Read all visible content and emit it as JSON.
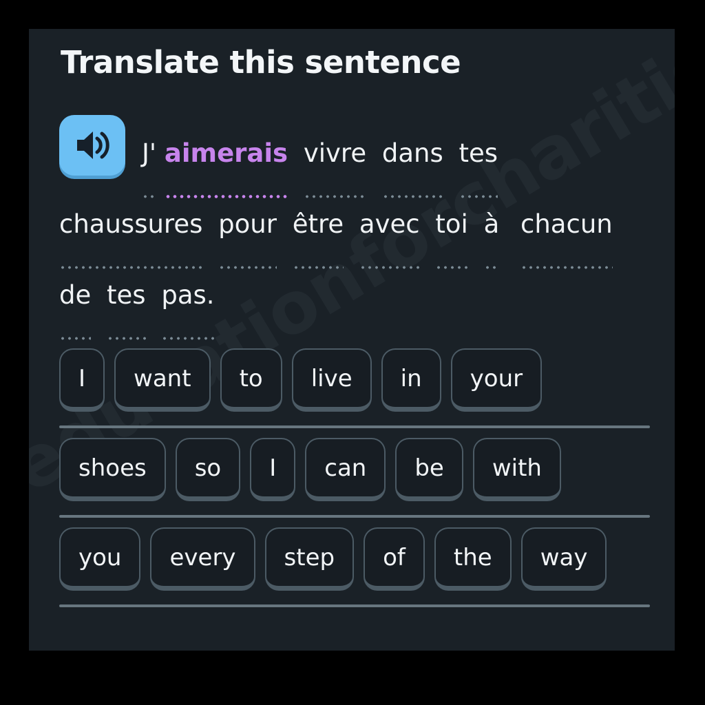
{
  "app": {
    "title": "Translate this sentence",
    "background_color": "#1a2127",
    "outer_color": "#000000",
    "watermark": "educationforcharities.com"
  },
  "audio": {
    "icon": "speaker-icon",
    "color": "#6cc0f4",
    "label": "Play audio"
  },
  "prompt": {
    "language": "French",
    "full_sentence": "J'aimerais vivre dans tes chaussures pour être avec toi à chacun de tes pas.",
    "highlight_color": "#c784ec",
    "words": [
      {
        "text": "J'",
        "highlighted": false,
        "nogap": true
      },
      {
        "text": "aimerais",
        "highlighted": true
      },
      {
        "text": "vivre",
        "highlighted": false
      },
      {
        "text": "dans",
        "highlighted": false
      },
      {
        "text": "tes",
        "highlighted": false
      },
      {
        "text": "chaussures",
        "highlighted": false
      },
      {
        "text": "pour",
        "highlighted": false
      },
      {
        "text": "être",
        "highlighted": false
      },
      {
        "text": "avec",
        "highlighted": false
      },
      {
        "text": "toi",
        "highlighted": false
      },
      {
        "text": "à",
        "highlighted": false,
        "wide": true
      },
      {
        "text": "chacun",
        "highlighted": false
      },
      {
        "text": "de",
        "highlighted": false
      },
      {
        "text": "tes",
        "highlighted": false
      },
      {
        "text": "pas.",
        "highlighted": false
      }
    ]
  },
  "word_bank": {
    "rows": [
      [
        "I",
        "want",
        "to",
        "live",
        "in",
        "your"
      ],
      [
        "shoes",
        "so",
        "I",
        "can",
        "be",
        "with"
      ],
      [
        "you",
        "every",
        "step",
        "of",
        "the",
        "way"
      ]
    ]
  }
}
